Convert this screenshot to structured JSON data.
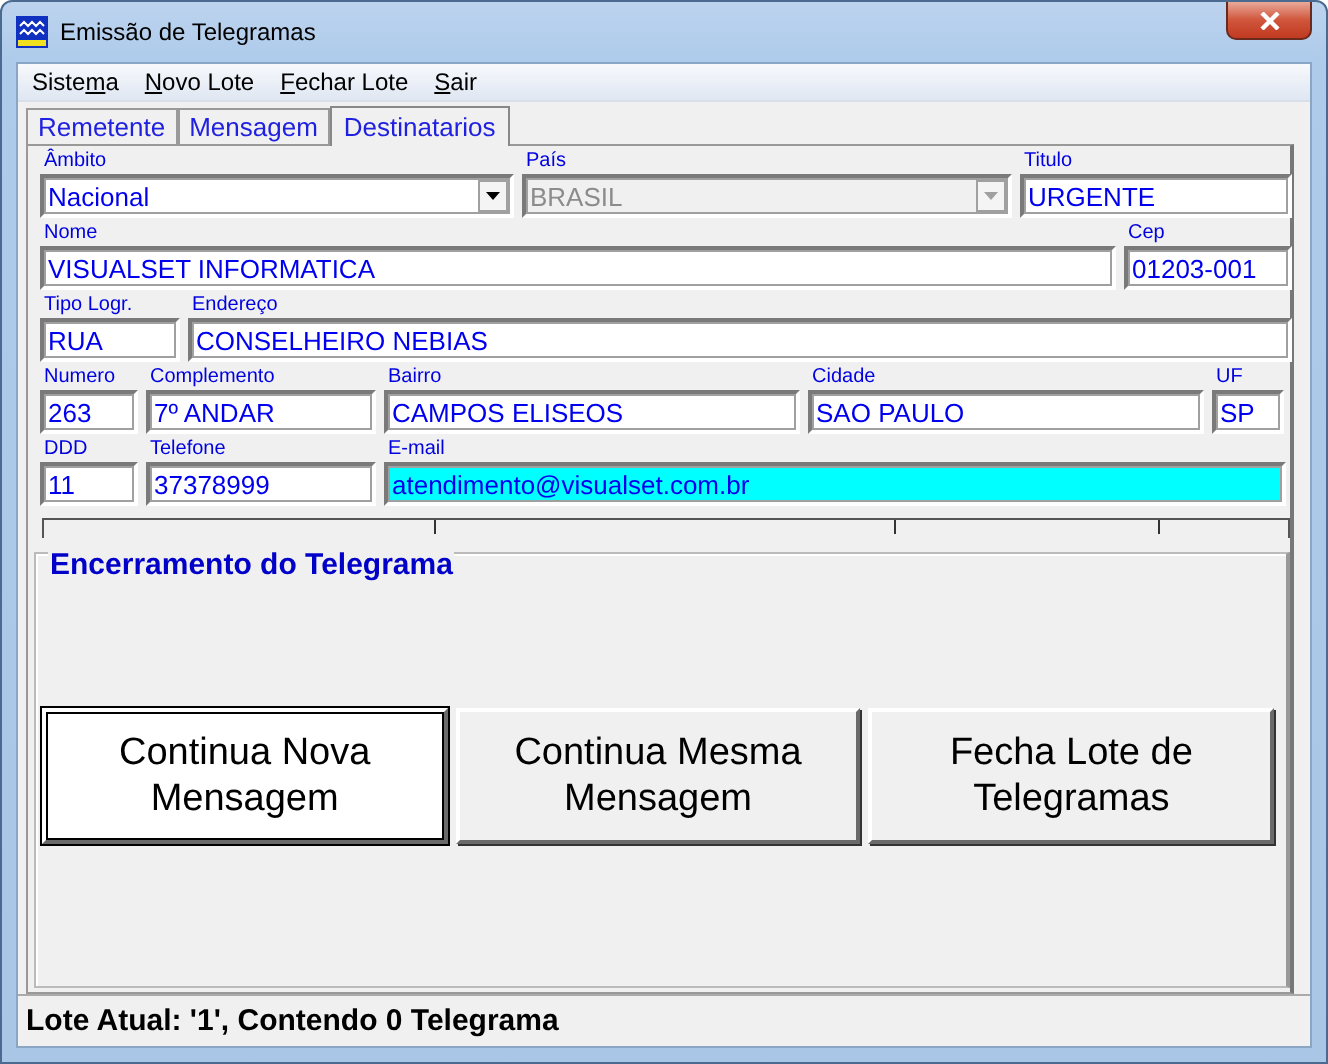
{
  "window": {
    "title": "Emissão de Telegramas"
  },
  "menu": [
    {
      "before": "Siste",
      "key": "m",
      "after": "a"
    },
    {
      "key": "N",
      "after": "ovo Lote"
    },
    {
      "key": "F",
      "after": "echar Lote"
    },
    {
      "key": "S",
      "after": "air"
    }
  ],
  "tabs": [
    {
      "label": "Remetente",
      "selected": false
    },
    {
      "label": "Mensagem",
      "selected": false
    },
    {
      "label": "Destinatarios",
      "selected": true
    }
  ],
  "rows": [
    [
      {
        "label": "Âmbito",
        "value": "Nacional",
        "kind": "dropdown",
        "disabled": false,
        "focused": false
      },
      {
        "label": "País",
        "value": "BRASIL",
        "kind": "dropdown",
        "disabled": true,
        "focused": false
      },
      {
        "label": "Titulo",
        "value": "URGENTE",
        "kind": "text",
        "disabled": false,
        "focused": false
      }
    ],
    [
      {
        "label": "Nome",
        "value": "VISUALSET INFORMATICA",
        "kind": "text",
        "disabled": false,
        "focused": false
      },
      {
        "label": "Cep",
        "value": "01203-001",
        "kind": "text",
        "disabled": false,
        "focused": false
      }
    ],
    [
      {
        "label": "Tipo Logr.",
        "value": "RUA",
        "kind": "text",
        "disabled": false,
        "focused": false
      },
      {
        "label": "Endereço",
        "value": "CONSELHEIRO NEBIAS",
        "kind": "text",
        "disabled": false,
        "focused": false
      }
    ],
    [
      {
        "label": "Numero",
        "value": "263",
        "kind": "text",
        "disabled": false,
        "focused": false
      },
      {
        "label": "Complemento",
        "value": "7º ANDAR",
        "kind": "text",
        "disabled": false,
        "focused": false
      },
      {
        "label": "Bairro",
        "value": "CAMPOS ELISEOS",
        "kind": "text",
        "disabled": false,
        "focused": false
      },
      {
        "label": "Cidade",
        "value": "SAO PAULO",
        "kind": "text",
        "disabled": false,
        "focused": false
      },
      {
        "label": "UF",
        "value": "SP",
        "kind": "text",
        "disabled": false,
        "focused": false
      }
    ],
    [
      {
        "label": "DDD",
        "value": "11",
        "kind": "text",
        "disabled": false,
        "focused": false
      },
      {
        "label": "Telefone",
        "value": "37378999",
        "kind": "text",
        "disabled": false,
        "focused": false
      },
      {
        "label": "E-mail",
        "value": "atendimento@visualset.com.br",
        "kind": "text",
        "disabled": false,
        "focused": true
      }
    ]
  ],
  "group": {
    "title": "Encerramento do Telegrama",
    "buttons": [
      {
        "label": "Continua Nova Mensagem",
        "focused": true
      },
      {
        "label": "Continua Mesma Mensagem",
        "focused": false
      },
      {
        "label": "Fecha Lote de Telegramas",
        "focused": false
      }
    ]
  },
  "status_bar": "Lote Atual: '1', Contendo 0 Telegrama"
}
